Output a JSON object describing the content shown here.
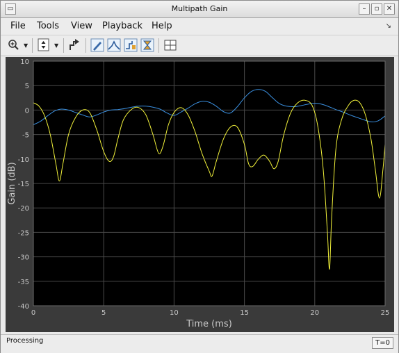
{
  "window": {
    "title": "Multipath Gain"
  },
  "menu": {
    "items": [
      {
        "label": "File"
      },
      {
        "label": "Tools"
      },
      {
        "label": "View"
      },
      {
        "label": "Playback"
      },
      {
        "label": "Help"
      }
    ]
  },
  "toolbar": {
    "tools": [
      "zoom-in-icon",
      "scale-axes-icon",
      "restore-icon",
      "edit-icon",
      "peak-icon",
      "step-icon",
      "cursor-icon",
      "layout-icon"
    ]
  },
  "status": {
    "text": "Processing",
    "time": "T=0"
  },
  "colors": {
    "series1": "#3a8fdf",
    "series2": "#f2f23a",
    "plot_bg": "#000000",
    "panel_bg": "#3a3a3a"
  },
  "chart_data": {
    "type": "line",
    "xlabel": "Time (ms)",
    "ylabel": "Gain (dB)",
    "xlim": [
      0,
      25
    ],
    "ylim": [
      -40,
      10
    ],
    "xticks": [
      "0",
      "5",
      "10",
      "15",
      "20",
      "25"
    ],
    "yticks": [
      "10",
      "5",
      "0",
      "-5",
      "-10",
      "-15",
      "-20",
      "-25",
      "-30",
      "-35",
      "-40"
    ],
    "grid": true,
    "series": [
      {
        "color": "#3a8fdf",
        "x": [
          0,
          0.5,
          1,
          1.5,
          2,
          2.5,
          3,
          3.5,
          4,
          4.5,
          5,
          5.5,
          6,
          6.5,
          7,
          7.5,
          8,
          8.5,
          9,
          9.5,
          10,
          10.5,
          11,
          11.5,
          12,
          12.5,
          13,
          13.5,
          14,
          14.5,
          15,
          15.5,
          16,
          16.5,
          17,
          17.5,
          18,
          18.5,
          19,
          19.5,
          20,
          20.5,
          21,
          21.5,
          22,
          22.5,
          23,
          23.5,
          24,
          24.5,
          25
        ],
        "values": [
          -3,
          -2.3,
          -1.2,
          -0.2,
          0.2,
          0,
          -0.5,
          -1,
          -1.4,
          -1,
          -0.4,
          0,
          0.1,
          0.3,
          0.6,
          0.8,
          0.8,
          0.6,
          0.2,
          -0.6,
          -1.1,
          -0.4,
          0.4,
          1.3,
          1.8,
          1.6,
          0.8,
          -0.3,
          -0.6,
          0.7,
          2.5,
          3.8,
          4.2,
          3.8,
          2.5,
          1.3,
          0.8,
          0.7,
          0.9,
          1.2,
          1.4,
          1.2,
          0.7,
          0.1,
          -0.4,
          -1,
          -1.5,
          -2,
          -2.4,
          -2.2,
          -1.2
        ]
      },
      {
        "color": "#f2f23a",
        "x": [
          0,
          0.4,
          0.8,
          1.2,
          1.6,
          1.85,
          2.1,
          2.5,
          3,
          3.5,
          4,
          4.5,
          5,
          5.4,
          5.7,
          6,
          6.4,
          7,
          7.5,
          8,
          8.5,
          8.9,
          9.2,
          9.6,
          10,
          10.5,
          11,
          11.5,
          12,
          12.5,
          12.7,
          13,
          13.5,
          14,
          14.5,
          15,
          15.3,
          15.6,
          16,
          16.4,
          16.8,
          17.1,
          17.4,
          17.8,
          18.3,
          18.8,
          19.3,
          19.8,
          20.2,
          20.6,
          20.9,
          21.05,
          21.2,
          21.5,
          21.9,
          22.4,
          22.8,
          23.2,
          23.6,
          24,
          24.3,
          24.6,
          24.85,
          25
        ],
        "values": [
          1.5,
          0.8,
          -1.2,
          -5,
          -11,
          -14.5,
          -11,
          -5,
          -1.5,
          0,
          -0.5,
          -4,
          -8.5,
          -10.5,
          -9.5,
          -6,
          -2,
          0.2,
          0.5,
          -1,
          -5,
          -8.8,
          -7.5,
          -3,
          -0.5,
          0.5,
          -1,
          -4.5,
          -9,
          -12.5,
          -13.5,
          -10.5,
          -6,
          -3.5,
          -3.5,
          -7,
          -11,
          -11.5,
          -10,
          -9.2,
          -10.5,
          -12,
          -10.5,
          -5,
          -0.5,
          1.5,
          2,
          1,
          -3,
          -12,
          -25,
          -32.5,
          -22,
          -8,
          -2,
          1,
          2,
          1.5,
          -1,
          -6,
          -12,
          -18,
          -12,
          -7
        ]
      }
    ]
  }
}
